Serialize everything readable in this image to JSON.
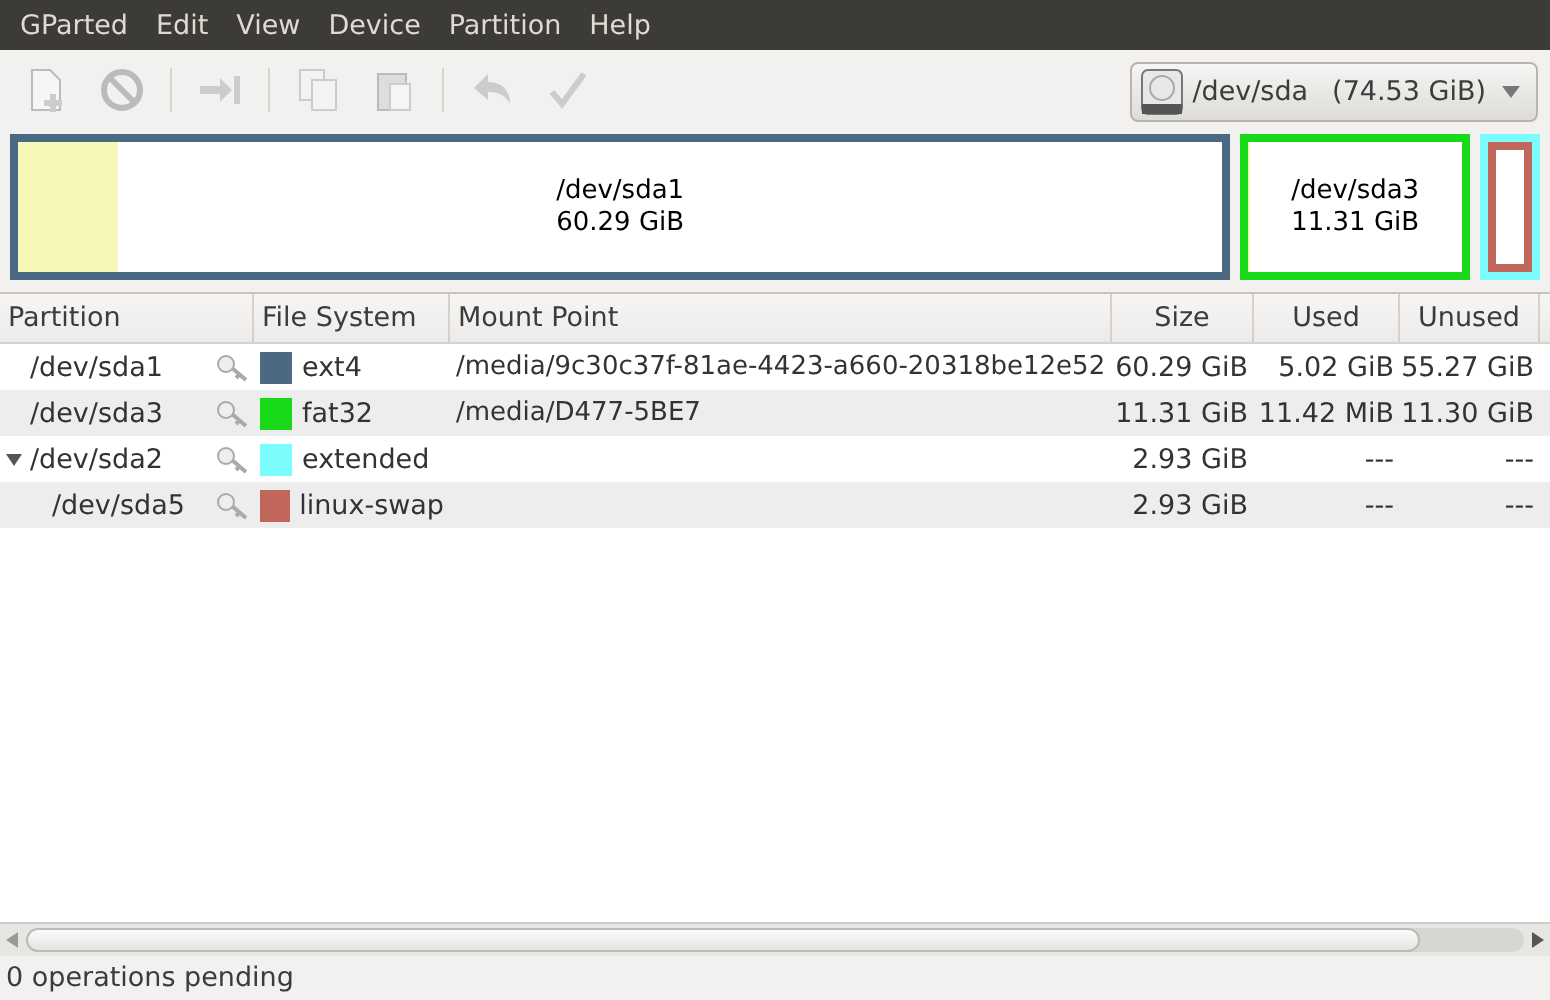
{
  "menu": [
    "GParted",
    "Edit",
    "View",
    "Device",
    "Partition",
    "Help"
  ],
  "toolbar": [
    {
      "kind": "new",
      "disabled": true
    },
    {
      "kind": "delete",
      "disabled": true
    },
    {
      "kind": "sep"
    },
    {
      "kind": "resize",
      "disabled": true
    },
    {
      "kind": "sep"
    },
    {
      "kind": "copy",
      "disabled": true
    },
    {
      "kind": "paste",
      "disabled": true
    },
    {
      "kind": "sep"
    },
    {
      "kind": "undo",
      "disabled": true
    },
    {
      "kind": "apply",
      "disabled": true
    }
  ],
  "device": {
    "name": "/dev/sda",
    "size": "(74.53 GiB)"
  },
  "disk_map": [
    {
      "kind": "partition",
      "name": "/dev/sda1",
      "size": "60.29 GiB",
      "color": "#4b6983",
      "level": 0.083
    },
    {
      "kind": "partition",
      "name": "/dev/sda3",
      "size": "11.31 GiB",
      "color": "#18d918",
      "level": 0.001
    },
    {
      "kind": "extended",
      "color": "#7dfcfe",
      "children": [
        {
          "color": "#c1665a"
        }
      ]
    }
  ],
  "table": {
    "columns": [
      "Partition",
      "File System",
      "Mount Point",
      "Size",
      "Used",
      "Unused"
    ],
    "rows": [
      {
        "partition": "/dev/sda1",
        "file_system": "ext4",
        "color": "#4b6983",
        "mount_point": "/media/9c30c37f-81ae-4423-a660-20318be12e52",
        "size": "60.29 GiB",
        "used": "5.02 GiB",
        "unused": "55.27 GiB"
      },
      {
        "partition": "/dev/sda3",
        "file_system": "fat32",
        "color": "#18d918",
        "mount_point": "/media/D477-5BE7",
        "size": "11.31 GiB",
        "used": "11.42 MiB",
        "unused": "11.30 GiB"
      },
      {
        "partition": "/dev/sda2",
        "file_system": "extended",
        "color": "#7dfcfe",
        "size": "2.93 GiB",
        "used": "---",
        "unused": "---",
        "expanded": true,
        "children": [
          {
            "partition": "/dev/sda5",
            "file_system": "linux-swap",
            "color": "#c1665a",
            "size": "2.93 GiB",
            "used": "---",
            "unused": "---"
          }
        ]
      }
    ]
  },
  "status_bar": "0 operations pending"
}
